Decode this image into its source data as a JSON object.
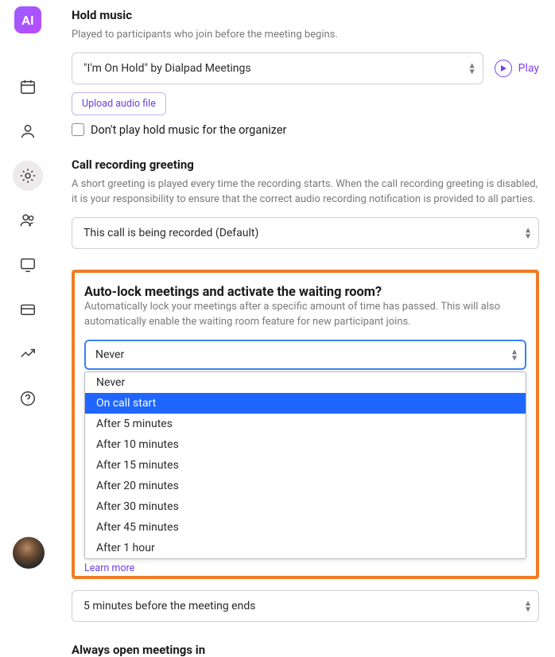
{
  "logo_text": "AI",
  "hold_music": {
    "title": "Hold music",
    "helper": "Played to participants who join before the meeting begins.",
    "selected": "\"I'm On Hold\" by Dialpad Meetings",
    "play_label": "Play",
    "upload_label": "Upload audio file",
    "checkbox_label": "Don't play hold music for the organizer"
  },
  "greeting": {
    "title": "Call recording greeting",
    "helper": "A short greeting is played every time the recording starts. When the call recording greeting is disabled, it is your responsibility to ensure that the correct audio recording notification is provided to all parties.",
    "selected": "This call is being recorded (Default)"
  },
  "autolock": {
    "title": "Auto-lock meetings and activate the waiting room?",
    "helper": "Automatically lock your meetings after a specific amount of time has passed. This will also automatically enable the waiting room feature for new participant joins.",
    "selected": "Never",
    "options": [
      "Never",
      "On call start",
      "After 5 minutes",
      "After 10 minutes",
      "After 15 minutes",
      "After 20 minutes",
      "After 30 minutes",
      "After 45 minutes",
      "After 1 hour"
    ],
    "highlighted_index": 1,
    "learn_more": "Learn more"
  },
  "wrapup": {
    "selected": "5 minutes before the meeting ends"
  },
  "next_section_title": "Always open meetings in"
}
